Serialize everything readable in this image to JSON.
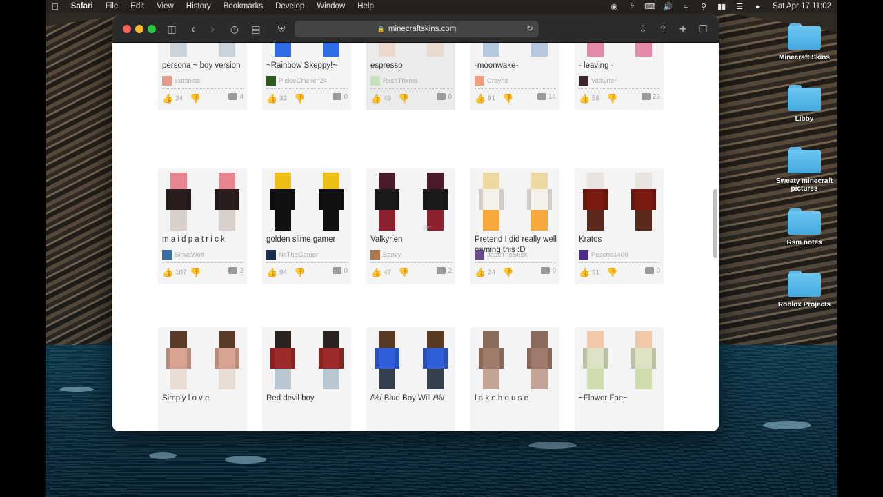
{
  "menubar": {
    "app": "Safari",
    "items": [
      "File",
      "Edit",
      "View",
      "History",
      "Bookmarks",
      "Develop",
      "Window",
      "Help"
    ],
    "clock": "Sat Apr 17  11:02"
  },
  "browser": {
    "url": "minecraftskins.com",
    "accent_colors": {
      "close": "#ff5f57",
      "minimize": "#febc2e",
      "zoom": "#28c840"
    }
  },
  "desktop_icons": [
    {
      "label": "Minecraft Skins"
    },
    {
      "label": "Libby"
    },
    {
      "label": "Sweaty minecraft pictures"
    },
    {
      "label": "Rsm notes"
    },
    {
      "label": "Roblox Projects"
    }
  ],
  "skins_rows": [
    [
      {
        "title": "persona ~ boy version",
        "author": "sxnshine",
        "likes": "24",
        "comments": "4",
        "head": "#d9c9a6",
        "body": "#8a9fb4",
        "legs": "#c9d3db",
        "avatar": "#e29d8b"
      },
      {
        "title": "~Rainbow Skeppy!~",
        "author": "PickleChicken24",
        "likes": "33",
        "comments": "0",
        "head": "#2fb7e8",
        "body": "#ff3fd3",
        "legs": "#2f6de8",
        "avatar": "#2e5a1e"
      },
      {
        "title": "espresso",
        "author": "RxseThxrns",
        "likes": "49",
        "comments": "0",
        "head": "#e8d6c8",
        "body": "#e7d2c2",
        "legs": "#ead9cd",
        "avatar": "#c9e2bd",
        "dim": true
      },
      {
        "title": "-moonwake-",
        "author": "Crayne",
        "likes": "91",
        "comments": "14",
        "head": "#e6ecf2",
        "body": "#a8c2dd",
        "legs": "#b7c9de",
        "avatar": "#f2a07b"
      },
      {
        "title": "- leaving -",
        "author": "Valkyrien",
        "likes": "58",
        "comments": "29",
        "head": "#f1a3b8",
        "body": "#c4455a",
        "legs": "#e58aa6",
        "avatar": "#3a2530"
      }
    ],
    [
      {
        "title": "m a i d p a t r i c k",
        "author": "SiriusWolf",
        "likes": "107",
        "comments": "2",
        "head": "#e6858f",
        "body": "#2a1d1d",
        "legs": "#d9d0cc",
        "avatar": "#3a6fa3"
      },
      {
        "title": "golden slime gamer",
        "author": "NitTheGamer",
        "likes": "94",
        "comments": "0",
        "head": "#f0bf16",
        "body": "#111111",
        "legs": "#111111",
        "avatar": "#1b2d4d"
      },
      {
        "title": "Valkyrien",
        "author": "Benvy",
        "likes": "47",
        "comments": "2",
        "head": "#4a1a2c",
        "body": "#1a1a1a",
        "legs": "#8e1f2f",
        "avatar": "#b0784f"
      },
      {
        "title": "Pretend I did really well naming this :D",
        "author": "JadeTheSnek",
        "likes": "24",
        "comments": "0",
        "head": "#eed8a2",
        "body": "#f6f0ea",
        "legs": "#f7a73c",
        "avatar": "#6a4c8c"
      },
      {
        "title": "Kratos",
        "author": "Peacho1400",
        "likes": "91",
        "comments": "0",
        "head": "#e8e4e0",
        "body": "#7a1b12",
        "legs": "#5a2a1c",
        "avatar": "#4b2b8c"
      }
    ],
    [
      {
        "title": "Simply l o v e",
        "author": "",
        "likes": "",
        "comments": "",
        "head": "#5b3a2a",
        "body": "#d8a393",
        "legs": "#e9dcd2",
        "avatar": "#ffffff"
      },
      {
        "title": "Red devil boy",
        "author": "",
        "likes": "",
        "comments": "",
        "head": "#2a2320",
        "body": "#9e2a2a",
        "legs": "#b9c7d3",
        "avatar": "#ffffff"
      },
      {
        "title": "/%/ Blue Boy Will /%/",
        "author": "",
        "likes": "",
        "comments": "",
        "head": "#5a3a20",
        "body": "#2f5ed8",
        "legs": "#34404d",
        "avatar": "#ffffff"
      },
      {
        "title": "l a k e h o u s e",
        "author": "",
        "likes": "",
        "comments": "",
        "head": "#8a6a5c",
        "body": "#a07a6a",
        "legs": "#c5a296",
        "avatar": "#ffffff"
      },
      {
        "title": "~Flower Fae~",
        "author": "",
        "likes": "",
        "comments": "",
        "head": "#f1c9a6",
        "body": "#dbe3c4",
        "legs": "#cfdcae",
        "avatar": "#ffffff"
      }
    ]
  ]
}
